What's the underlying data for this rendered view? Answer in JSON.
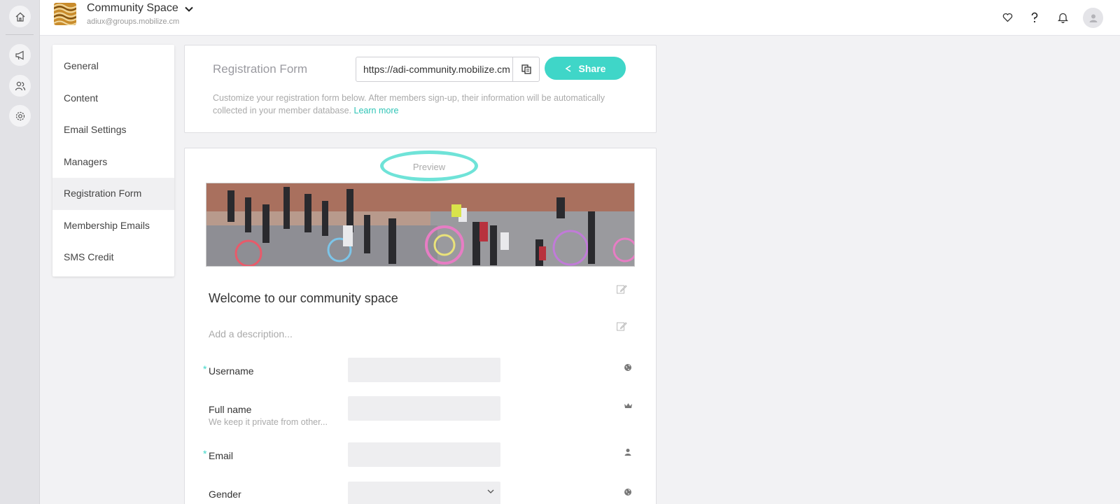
{
  "app": {
    "title": "Community Space",
    "subtitle": "adiux@groups.mobilize.cm"
  },
  "rail": {
    "icons": [
      "home-icon",
      "megaphone-icon",
      "people-icon",
      "gear-icon"
    ]
  },
  "topbar": {
    "icons": [
      "heart-icon",
      "help-icon",
      "bell-icon",
      "avatar-icon"
    ]
  },
  "nav": {
    "items": [
      {
        "label": "General"
      },
      {
        "label": "Content"
      },
      {
        "label": "Email Settings"
      },
      {
        "label": "Managers"
      },
      {
        "label": "Registration Form",
        "active": true
      },
      {
        "label": "Membership Emails"
      },
      {
        "label": "SMS Credit"
      }
    ]
  },
  "registration": {
    "title": "Registration Form",
    "url": "https://adi-community.mobilize.cm",
    "share_label": "Share",
    "description": "Customize your registration form below. After members sign-up, their information will be automatically collected in your member database.",
    "learn_more": "Learn more"
  },
  "preview": {
    "label": "Preview",
    "welcome": "Welcome to our community space",
    "description_placeholder": "Add a description...",
    "fields": [
      {
        "label": "Username",
        "required": true,
        "icon": "globe-icon"
      },
      {
        "label": "Full name",
        "sublabel": "We keep it private from other...",
        "required": false,
        "icon": "crown-icon"
      },
      {
        "label": "Email",
        "required": true,
        "icon": "person-icon"
      },
      {
        "label": "Gender",
        "required": false,
        "icon": "globe-icon"
      }
    ]
  },
  "colors": {
    "accent": "#3fd6c8",
    "highlight_ring": "#6fe3d8"
  }
}
